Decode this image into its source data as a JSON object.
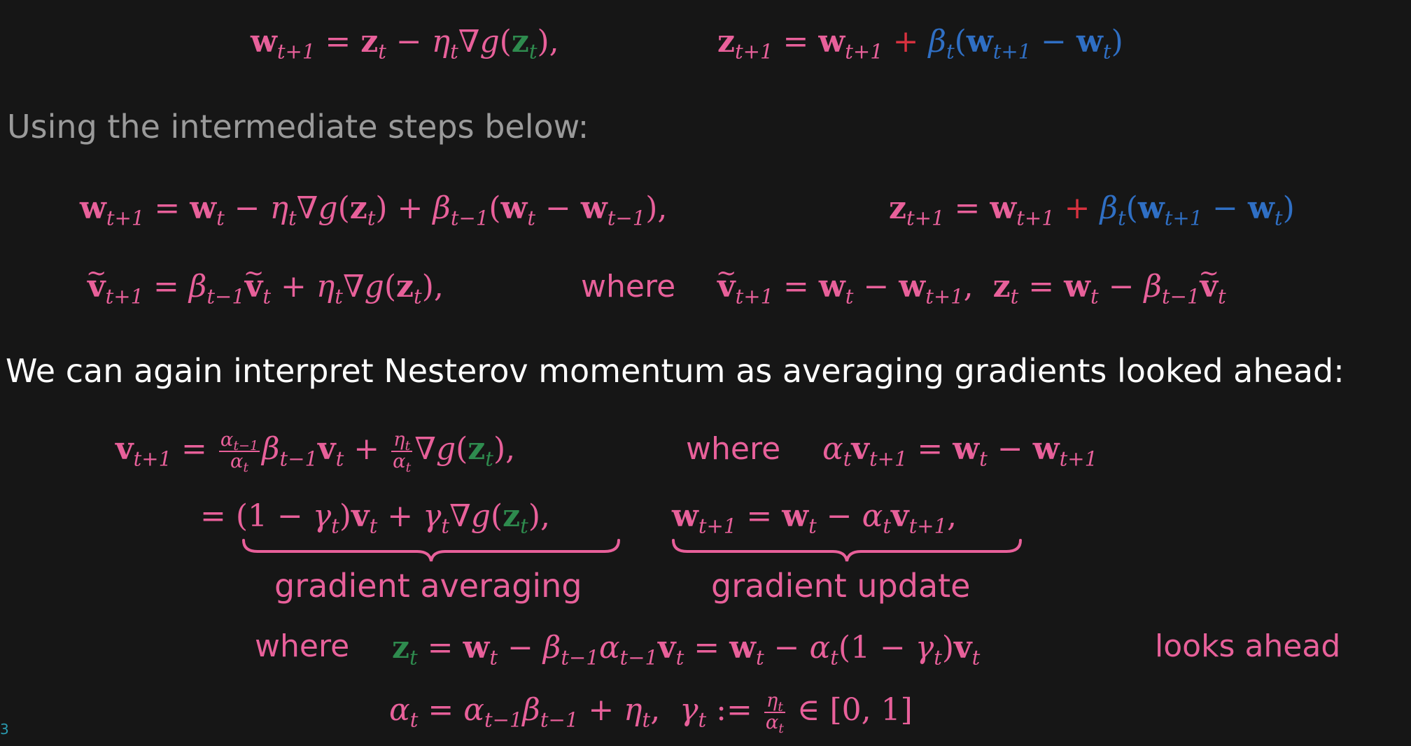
{
  "text": {
    "intro": "Using the intermediate steps below:",
    "interpret": "We can again interpret Nesterov momentum as averaging gradients looked ahead:",
    "where": "where",
    "gradient_averaging": "gradient averaging",
    "gradient_update": "gradient update",
    "looks_ahead": "looks ahead",
    "page_number": "3"
  },
  "colors": {
    "formula": "#e8609a",
    "lookahead_point": "#2e8b4e",
    "momentum_term": "#2f6fc4",
    "plus_sign": "#d8313f",
    "intro_text": "#9a9a9a",
    "body_text": "#ffffff",
    "background": "#161616",
    "page_number": "#2a9bb0"
  }
}
